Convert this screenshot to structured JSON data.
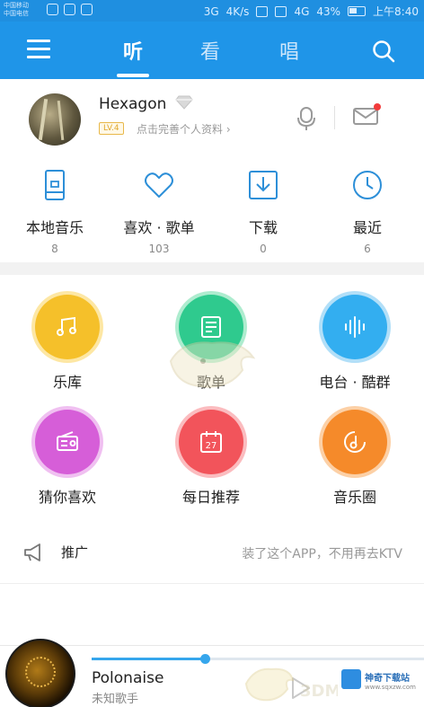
{
  "status_bar": {
    "left_text_1": "中国移动",
    "left_text_2": "中国电信",
    "signal_1": "3G",
    "speed": "4K/s",
    "signal_2": "4G",
    "battery_percent": "43%",
    "time": "上午8:40"
  },
  "top_nav": {
    "tabs": [
      {
        "label": "听",
        "active": true
      },
      {
        "label": "看",
        "active": false
      },
      {
        "label": "唱",
        "active": false
      }
    ]
  },
  "profile": {
    "username": "Hexagon",
    "level": "LV.4",
    "hint": "点击完善个人资料 ›"
  },
  "quick_row": [
    {
      "label": "本地音乐",
      "count": "8",
      "icon": "phone-music-icon"
    },
    {
      "label": "喜欢 · 歌单",
      "count": "103",
      "icon": "heart-icon"
    },
    {
      "label": "下载",
      "count": "0",
      "icon": "download-icon"
    },
    {
      "label": "最近",
      "count": "6",
      "icon": "clock-icon"
    }
  ],
  "grid": [
    {
      "label": "乐库",
      "color": "#f5c02a",
      "icon": "music-note-icon"
    },
    {
      "label": "歌单",
      "color": "#2fca8e",
      "icon": "playlist-icon"
    },
    {
      "label": "电台 · 酷群",
      "color": "#33aef0",
      "icon": "radio-wave-icon"
    },
    {
      "label": "猜你喜欢",
      "color": "#d65ed8",
      "icon": "radio-icon"
    },
    {
      "label": "每日推荐",
      "color": "#f2545b",
      "icon": "calendar-icon",
      "calendar_day": "27"
    },
    {
      "label": "音乐圈",
      "color": "#f58a2a",
      "icon": "music-circle-icon"
    }
  ],
  "promo": {
    "label": "推广",
    "text": "装了这个APP，不用再去KTV"
  },
  "player": {
    "title": "Polonaise",
    "artist": "未知歌手",
    "progress": 0.34
  },
  "watermark": {
    "brand": "神奇下载站",
    "sub": "www.sqxzw.com",
    "faint": "3DM"
  },
  "colors": {
    "nav_blue": "#1f95e8",
    "accent_blue": "#36a6ec",
    "icon_blue": "#2d8fd8"
  }
}
